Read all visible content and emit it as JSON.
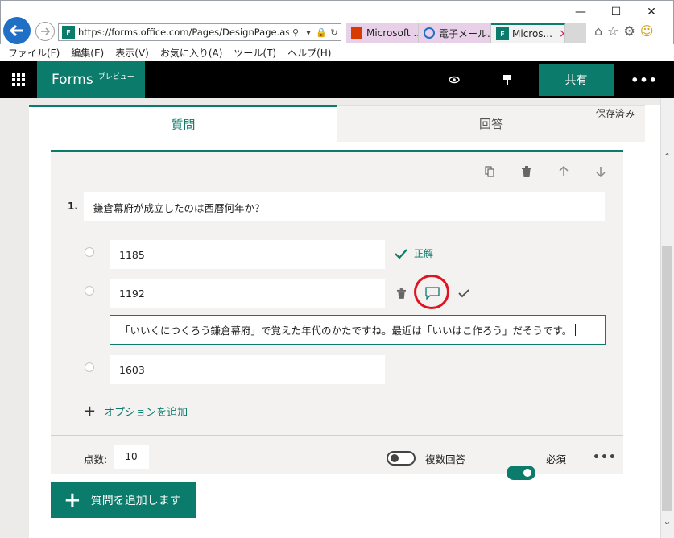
{
  "browser": {
    "url": "https://forms.office.com/Pages/DesignPage.aspx",
    "tabs": [
      {
        "label": "Microsoft ..."
      },
      {
        "label": "電子メール..."
      },
      {
        "label": "Micros...",
        "close": "×"
      }
    ],
    "menu": [
      "ファイル(F)",
      "編集(E)",
      "表示(V)",
      "お気に入り(A)",
      "ツール(T)",
      "ヘルプ(H)"
    ]
  },
  "header": {
    "app_name": "Forms",
    "preview_badge": "プレビュー",
    "share_label": "共有",
    "more": "•••"
  },
  "tabs": {
    "questions": "質問",
    "responses": "回答"
  },
  "saved_status": "保存済み",
  "question": {
    "number": "1.",
    "title": "鎌倉幕府が成立したのは西暦何年か？",
    "options": [
      {
        "text": "1185",
        "correct": true
      },
      {
        "text": "1192",
        "correct": false
      },
      {
        "text": "1603",
        "correct": false
      }
    ],
    "correct_label": "正解",
    "feedback": "「いいくにつくろう鎌倉幕府」で覚えた年代のかたですね。最近は「いいはこ作ろう」だそうです。",
    "add_option": "オプションを追加",
    "points_label": "点数:",
    "points_value": "10",
    "multiple_answers_label": "複数回答",
    "multiple_answers_on": false,
    "required_label": "必須",
    "required_on": true,
    "more": "•••"
  },
  "add_question_label": "質問を追加します",
  "colors": {
    "accent": "#0b7b6b",
    "highlight": "#e0141e"
  }
}
